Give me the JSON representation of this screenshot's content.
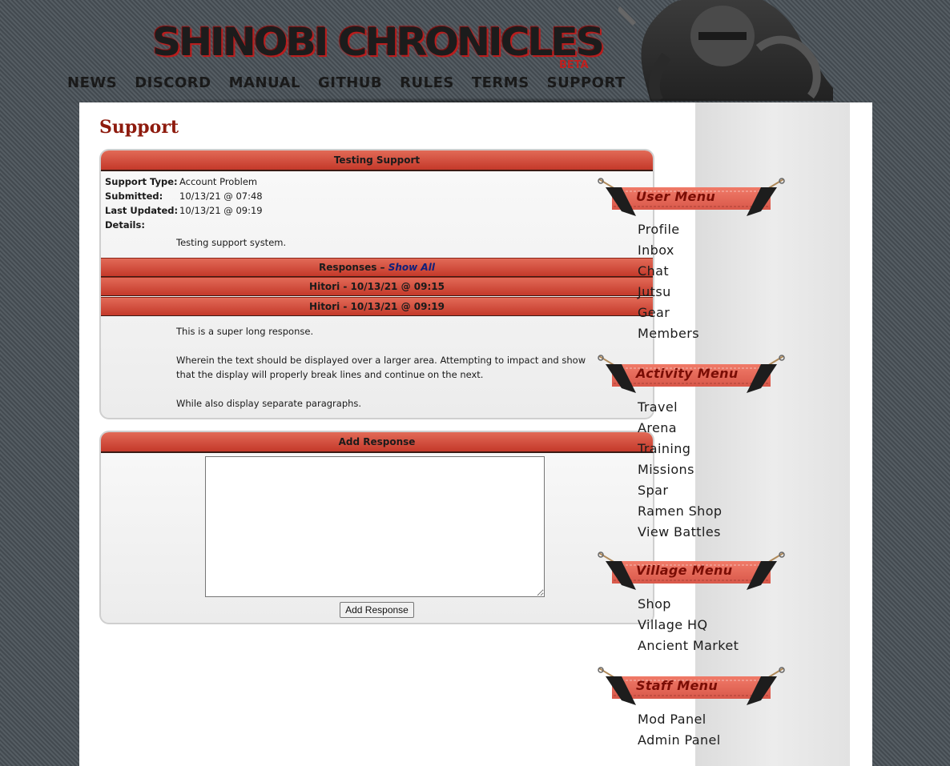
{
  "header": {
    "logo_text": "SHINOBI CHRONICLES",
    "logo_badge": "BETA",
    "nav": [
      "NEWS",
      "DISCORD",
      "MANUAL",
      "GITHUB",
      "RULES",
      "TERMS",
      "SUPPORT"
    ]
  },
  "main": {
    "page_title": "Support",
    "ticket": {
      "title": "Testing Support",
      "support_type_label": "Support Type:",
      "support_type": "Account Problem",
      "submitted_label": "Submitted:",
      "submitted": "10/13/21 @ 07:48",
      "last_updated_label": "Last Updated:",
      "last_updated": "10/13/21 @ 09:19",
      "details_label": "Details:",
      "details": "Testing support system."
    },
    "responses": {
      "header_label": "Responses – ",
      "show_all_label": "Show All",
      "items": [
        {
          "header": "Hitori - 10/13/21 @ 09:15"
        },
        {
          "header": "Hitori - 10/13/21 @ 09:19"
        }
      ],
      "body": [
        "This is a super long response.",
        "Wherein the text should be displayed over a larger area. Attempting to impact and show that the display will properly break lines and continue on the next.",
        "While also display separate paragraphs."
      ]
    },
    "add_response": {
      "title": "Add Response",
      "textarea_value": "",
      "button_label": "Add Response"
    }
  },
  "sidebar": {
    "menus": [
      {
        "title": "User Menu",
        "items": [
          "Profile",
          "Inbox",
          "Chat",
          "Jutsu",
          "Gear",
          "Members"
        ]
      },
      {
        "title": "Activity Menu",
        "items": [
          "Travel",
          "Arena",
          "Training",
          "Missions",
          "Spar",
          "Ramen Shop",
          "View Battles"
        ]
      },
      {
        "title": "Village Menu",
        "items": [
          "Shop",
          "Village HQ",
          "Ancient Market"
        ]
      },
      {
        "title": "Staff Menu",
        "items": [
          "Mod Panel",
          "Admin Panel"
        ]
      }
    ]
  },
  "colors": {
    "accent_red": "#c4392a",
    "title_red": "#8e1b0e",
    "menu_title_red": "#7a0d05",
    "background": "#4a5258"
  }
}
